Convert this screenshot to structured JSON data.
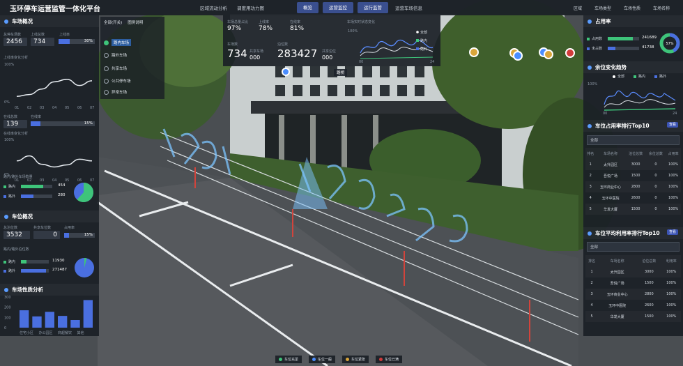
{
  "app": {
    "title": "玉环停车运营监管一体化平台"
  },
  "topnav": {
    "items": [
      "区域流动分析",
      "调度用功力图",
      "概览",
      "运营监控",
      "运行监管",
      "运营车场信息"
    ]
  },
  "rightnav": {
    "items": [
      "区域",
      "车场类型",
      "车场性质",
      "车场名称"
    ]
  },
  "left": {
    "s1": {
      "title": "车场概况",
      "labels": [
        "总停车场数",
        "上线总数",
        "上线率"
      ],
      "values": [
        "2456",
        "734",
        "30%"
      ],
      "rate": 0.3
    },
    "trend1": {
      "title": "上线率变化分析",
      "ymax": "100%",
      "ymin": "0%",
      "x": [
        "01",
        "02",
        "03",
        "04",
        "05",
        "06",
        "07"
      ],
      "values": [
        15,
        20,
        35,
        55,
        62,
        45,
        58
      ]
    },
    "s2": {
      "labels": [
        "在线总数",
        "在线率"
      ],
      "values": [
        "139",
        "15%"
      ],
      "rate": 0.15
    },
    "trend2": {
      "title": "在线率变化分析",
      "ymax": "100%",
      "ymin": "0%",
      "x": [
        "01",
        "02",
        "03",
        "04",
        "05",
        "06",
        "07"
      ],
      "values": [
        40,
        55,
        30,
        22,
        28,
        45,
        40
      ]
    },
    "pie1": {
      "title": "路内/路外车场数量",
      "items": [
        {
          "name": "路内",
          "value": "454",
          "color": "#3ec47a"
        },
        {
          "name": "路外",
          "value": "280",
          "color": "#4a6fe0"
        }
      ],
      "share": 0.62
    },
    "s3": {
      "title": "车位概况",
      "labels": [
        "总泊位数",
        "共享车位数",
        "占用率"
      ],
      "values": [
        "3532",
        "0",
        "15%"
      ],
      "rate": 0.15
    },
    "pie2": {
      "title": "路内/路外泊位数",
      "items": [
        {
          "name": "路内",
          "value": "11930",
          "color": "#3ec47a"
        },
        {
          "name": "路外",
          "value": "271487",
          "color": "#4a6fe0"
        }
      ],
      "share": 0.04
    },
    "s4": {
      "title": "车场性质分析"
    },
    "bars": {
      "ticks": [
        "300",
        "200",
        "100",
        "0"
      ],
      "categories": [
        "住宅小区",
        "办公园区",
        "商超餐饮",
        "其他"
      ],
      "values": [
        170,
        110,
        155,
        115,
        75,
        270
      ]
    }
  },
  "layers": {
    "header": [
      "全部(开关)",
      "图例说明"
    ],
    "items": [
      "路内车场",
      "路外车场",
      "共享车场",
      "公共停车场",
      "异常车场"
    ]
  },
  "stats": {
    "labels": [
      "车场总量占比",
      "上线率",
      "在线率"
    ],
    "values": [
      "97%",
      "78%",
      "81%"
    ],
    "c1": {
      "label": "车场数",
      "value": "734",
      "sub_label": "共享车场",
      "sub_value": "000"
    },
    "c2": {
      "label": "泊位数",
      "value": "283427",
      "sub_label": "共享泊位",
      "sub_value": "000"
    },
    "trend": {
      "title": "车场实时状态变化",
      "ymax": "100%",
      "x0": "00",
      "x1": "24",
      "legend": [
        "全部",
        "路内",
        "路外"
      ]
    }
  },
  "scene": {
    "label": "路桥"
  },
  "right": {
    "occ": {
      "title": "占用率",
      "items": [
        {
          "name": "占用数",
          "value": "241689"
        },
        {
          "name": "未占数",
          "value": "41738"
        }
      ],
      "center": "57%"
    },
    "trend": {
      "title": "余位变化趋势",
      "legend": [
        "全部",
        "路内",
        "路外"
      ],
      "ymax": "100%",
      "x0": "00",
      "x1": "24"
    },
    "top1": {
      "title": "车位占用率排行Top10",
      "btn": "查看",
      "filter": "全部",
      "headers": [
        "排名",
        "车场名称",
        "泊位总数",
        "余位总数",
        "占用率"
      ],
      "rows": [
        [
          "1",
          "太升园区",
          "3000",
          "0",
          "100%"
        ],
        [
          "2",
          "吾悦广场",
          "1500",
          "0",
          "100%"
        ],
        [
          "3",
          "玉环商业中心",
          "2800",
          "0",
          "100%"
        ],
        [
          "4",
          "玉环中医院",
          "2600",
          "0",
          "100%"
        ],
        [
          "5",
          "华发大厦",
          "1500",
          "0",
          "100%"
        ]
      ]
    },
    "top2": {
      "title": "车位平均利用率排行Top10",
      "btn": "查看",
      "filter": "全部",
      "headers": [
        "排名",
        "车场名称",
        "泊位总数",
        "利用率"
      ],
      "rows": [
        [
          "1",
          "太升园区",
          "3000",
          "100%"
        ],
        [
          "2",
          "吾悦广场",
          "1500",
          "100%"
        ],
        [
          "3",
          "玉环商业中心",
          "2800",
          "100%"
        ],
        [
          "4",
          "玉环中医院",
          "2600",
          "100%"
        ],
        [
          "5",
          "华发大厦",
          "1500",
          "100%"
        ]
      ]
    }
  },
  "bottom": {
    "legend": [
      {
        "name": "车位充足",
        "color": "#3ec47a"
      },
      {
        "name": "车位一般",
        "color": "#4a8dff"
      },
      {
        "name": "车位紧张",
        "color": "#d9a53a"
      },
      {
        "name": "车位已满",
        "color": "#d23b3b"
      }
    ]
  }
}
